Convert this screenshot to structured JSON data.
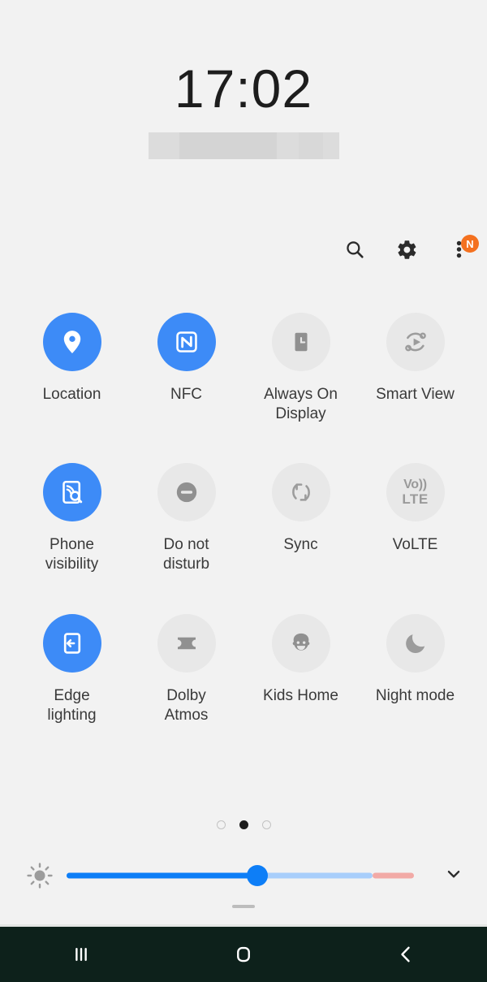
{
  "status": {
    "clock": "17:02",
    "date_redacted": true
  },
  "header": {
    "search_icon": "search-icon",
    "settings_icon": "gear-icon",
    "overflow_icon": "three-dot-menu-icon",
    "overflow_badge": "N"
  },
  "colors": {
    "background": "#f2f2f2",
    "toggle_on": "#3d8bf7",
    "toggle_off": "#e8e8e8",
    "icon_off": "#909090",
    "badge": "#f4711f",
    "highlight": "#ff00ff",
    "slider_fill": "#0d7ef7",
    "slider_track": "#a8cefb",
    "slider_extra": "#f2aaa6",
    "navbar": "#0d211b"
  },
  "quick_settings": {
    "tiles": [
      {
        "label": "Location",
        "icon": "location-pin-icon",
        "state": "on"
      },
      {
        "label": "NFC",
        "icon": "nfc-icon",
        "state": "on"
      },
      {
        "label": "Always On\nDisplay",
        "icon": "always-on-display-icon",
        "state": "off"
      },
      {
        "label": "Smart View",
        "icon": "smart-view-icon",
        "state": "off",
        "highlighted": true
      },
      {
        "label": "Phone\nvisibility",
        "icon": "phone-visibility-icon",
        "state": "on"
      },
      {
        "label": "Do not\ndisturb",
        "icon": "do-not-disturb-icon",
        "state": "off"
      },
      {
        "label": "Sync",
        "icon": "sync-icon",
        "state": "off"
      },
      {
        "label": "VoLTE",
        "icon": "volte-icon",
        "state": "off",
        "icon_text": [
          "Vo))",
          "LTE"
        ]
      },
      {
        "label": "Edge\nlighting",
        "icon": "edge-lighting-icon",
        "state": "on"
      },
      {
        "label": "Dolby\nAtmos",
        "icon": "dolby-atmos-icon",
        "state": "off"
      },
      {
        "label": "Kids Home",
        "icon": "kids-home-icon",
        "state": "off"
      },
      {
        "label": "Night mode",
        "icon": "night-mode-moon-icon",
        "state": "off"
      }
    ]
  },
  "pager": {
    "total_pages": 3,
    "active_page": 2
  },
  "brightness": {
    "icon": "brightness-sun-icon",
    "value_percent": 55,
    "expand_icon": "chevron-down-icon"
  },
  "nav_bar": {
    "recents": "recents-icon",
    "home": "home-icon",
    "back": "back-icon"
  }
}
